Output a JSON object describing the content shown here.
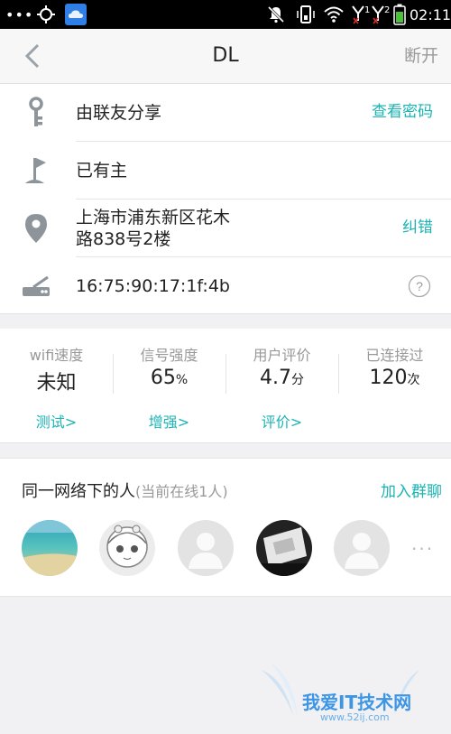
{
  "status_bar": {
    "dots": "•••",
    "time": "02:11",
    "sim1": "1",
    "sim2": "2"
  },
  "header": {
    "title": "DL",
    "disconnect_label": "断开"
  },
  "info": {
    "share": {
      "text": "由联友分享",
      "action": "查看密码"
    },
    "owner": {
      "text": "已有主"
    },
    "location": {
      "line1": "上海市浦东新区花木",
      "line2": "路838号2楼",
      "action": "纠错"
    },
    "mac": {
      "text": "16:75:90:17:1f:4b"
    }
  },
  "stats": [
    {
      "label": "wifi速度",
      "value": "未知",
      "unit": "",
      "link": "测试>"
    },
    {
      "label": "信号强度",
      "value": "65",
      "unit": "%",
      "link": "增强>"
    },
    {
      "label": "用户评价",
      "value": "4.7",
      "unit": "分",
      "link": "评价>"
    },
    {
      "label": "已连接过",
      "value": "120",
      "unit": "次",
      "link": ""
    }
  ],
  "people": {
    "title": "同一网络下的人",
    "subtitle": "(当前在线1人)",
    "join_label": "加入群聊",
    "more": "···"
  },
  "watermark": {
    "text": "我爱IT技术网",
    "url": "www.52ij.com"
  },
  "colors": {
    "accent": "#1bb3b3",
    "icon_gray": "#8d949a"
  }
}
